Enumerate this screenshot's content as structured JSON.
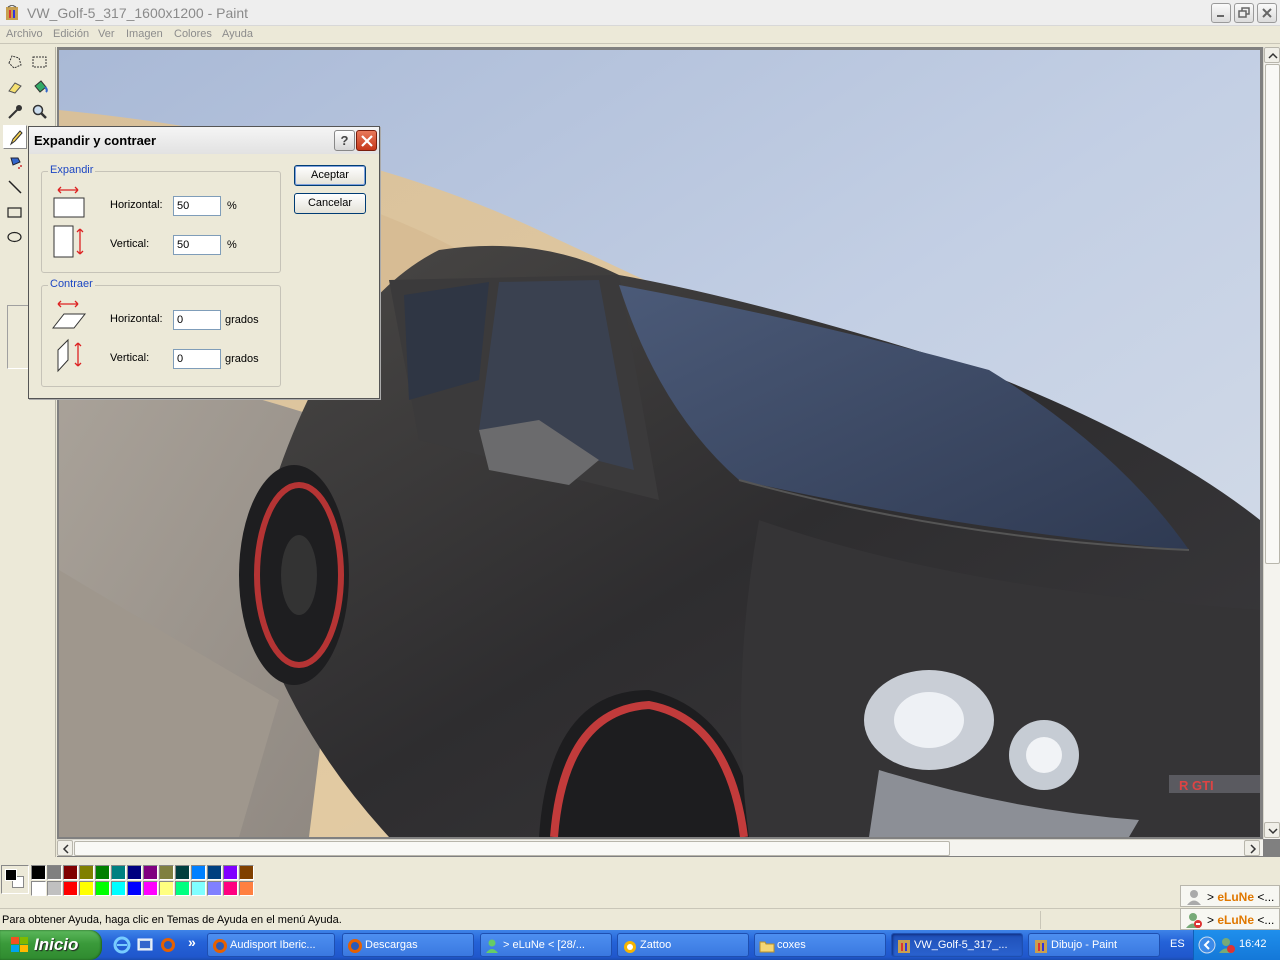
{
  "window": {
    "title": "VW_Golf-5_317_1600x1200 - Paint"
  },
  "menu": [
    "Archivo",
    "Edición",
    "Ver",
    "Imagen",
    "Colores",
    "Ayuda"
  ],
  "status": {
    "help_text": "Para obtener Ayuda, haga clic en Temas de Ayuda en el menú Ayuda."
  },
  "dialog": {
    "title": "Expandir y contraer",
    "help_label": "?",
    "expand": {
      "legend": "Expandir",
      "horizontal_label": "Horizontal:",
      "horizontal_value": "50",
      "horizontal_unit": "%",
      "vertical_label": "Vertical:",
      "vertical_value": "50",
      "vertical_unit": "%"
    },
    "skew": {
      "legend": "Contraer",
      "horizontal_label": "Horizontal:",
      "horizontal_value": "0",
      "horizontal_unit": "grados",
      "vertical_label": "Vertical:",
      "vertical_value": "0",
      "vertical_unit": "grados"
    },
    "ok_label": "Aceptar",
    "cancel_label": "Cancelar"
  },
  "palette": {
    "foreground": "#000000",
    "background": "#ffffff",
    "top_row": [
      "#000000",
      "#808080",
      "#800000",
      "#808000",
      "#008000",
      "#008080",
      "#000080",
      "#800080",
      "#808040",
      "#004040",
      "#0080ff",
      "#004080",
      "#8000ff",
      "#804000"
    ],
    "bottom_row": [
      "#ffffff",
      "#c0c0c0",
      "#ff0000",
      "#ffff00",
      "#00ff00",
      "#00ffff",
      "#0000ff",
      "#ff00ff",
      "#ffff80",
      "#00ff80",
      "#80ffff",
      "#8080ff",
      "#ff0080",
      "#ff8040"
    ]
  },
  "messenger": {
    "toast1_prefix": "> ",
    "toast1_name": "eLuNe",
    "toast1_suffix": " <...",
    "toast2_prefix": "> ",
    "toast2_name": "eLuNe",
    "toast2_suffix": " <..."
  },
  "taskbar": {
    "start_label": "Inicio",
    "more_label": "»",
    "tasks": [
      {
        "label": "Audisport Iberic..."
      },
      {
        "label": "Descargas"
      },
      {
        "label": "> eLuNe < [28/..."
      },
      {
        "label": "Zattoo"
      },
      {
        "label": "coxes"
      },
      {
        "label": "VW_Golf-5_317_..."
      },
      {
        "label": "Dibujo - Paint"
      }
    ],
    "language": "ES",
    "clock": "16:42"
  }
}
